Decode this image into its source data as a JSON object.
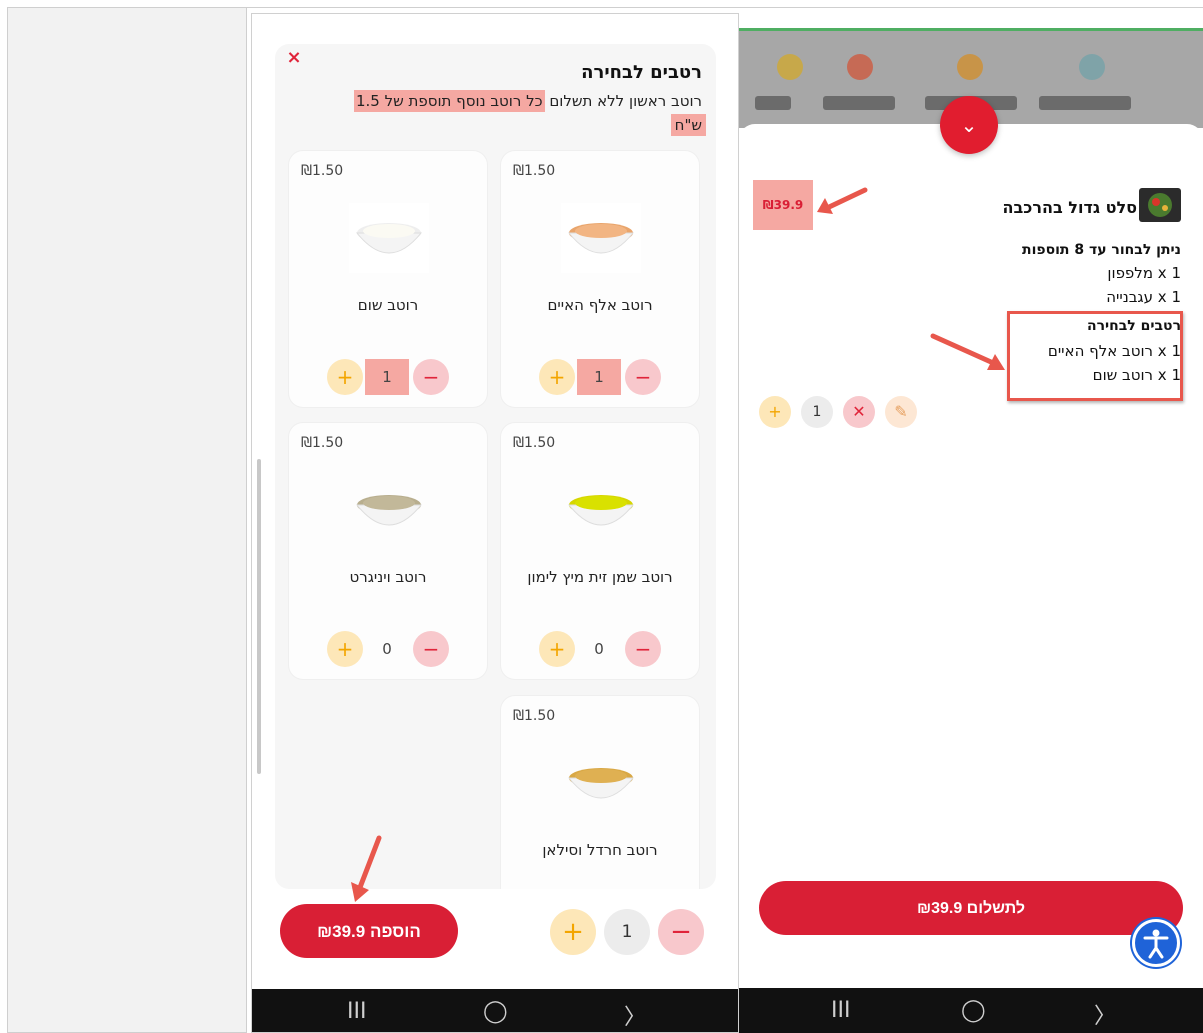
{
  "left_phone": {
    "close_glyph": "×",
    "title": "רטבים לבחירה",
    "desc_plain": "רוטב ראשון ללא תשלום",
    "desc_highlight": "כל רוטב נוסף תוספת של 1.5",
    "desc_highlight_2": "ש\"ח",
    "cards": [
      {
        "name": "רוטב אלף האיים",
        "price": "₪1.50",
        "qty": "1"
      },
      {
        "name": "רוטב שום",
        "price": "₪1.50",
        "qty": "1"
      },
      {
        "name": "רוטב שמן זית מיץ לימון",
        "price": "₪1.50",
        "qty": "0"
      },
      {
        "name": "רוטב ויניגרט",
        "price": "₪1.50",
        "qty": "0"
      },
      {
        "name": "רוטב חרדל וסילאן",
        "price": "₪1.50",
        "qty": ""
      }
    ],
    "add_button": "הוספה ₪39.9",
    "bottom_qty": "1",
    "plus_glyph": "+",
    "minus_glyph": "−",
    "nav": {
      "recents": "III",
      "home": "◯",
      "back": "〉"
    }
  },
  "right_phone": {
    "chevron_glyph": "⌄",
    "item_title": "סלט גדול בהרכבה",
    "item_price": "₪39.9",
    "section1": "ניתן לבחור עד 8 תוספות",
    "lines1": [
      "1 x מלפפון",
      "1 x עגבנייה"
    ],
    "section2": "רטבים לבחירה",
    "lines2": [
      "1 x רוטב אלף האיים",
      "1 x רוטב שום"
    ],
    "item_qty": "1",
    "remove_glyph": "✕",
    "edit_glyph": "✎",
    "pay_button": "לתשלום ₪39.9",
    "nav": {
      "recents": "III",
      "home": "◯",
      "back": "〉"
    }
  },
  "colors": {
    "brand_red": "#d91f35",
    "plus_yellow": "#fde7b8",
    "minus_pink": "#f8c8cc",
    "highlight": "#f5a8a2",
    "annotation_arrow": "#e8574c"
  }
}
